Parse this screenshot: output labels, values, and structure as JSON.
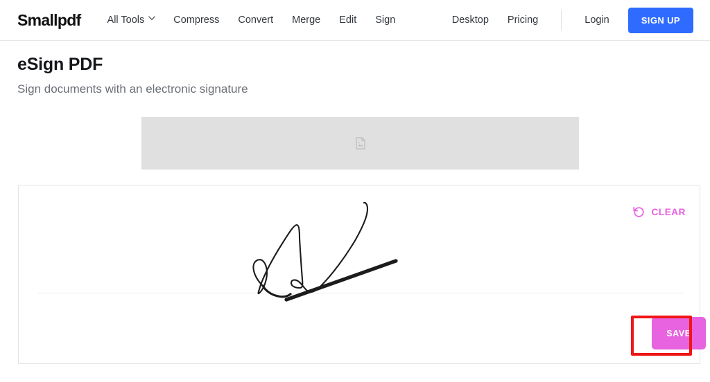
{
  "header": {
    "logo": "Smallpdf",
    "nav_main": [
      {
        "label": "All Tools",
        "icon": "chevron-down-icon",
        "has_chevron": true
      },
      {
        "label": "Compress",
        "has_chevron": false
      },
      {
        "label": "Convert",
        "has_chevron": false
      },
      {
        "label": "Merge",
        "has_chevron": false
      },
      {
        "label": "Edit",
        "has_chevron": false
      },
      {
        "label": "Sign",
        "has_chevron": false
      }
    ],
    "nav_right": [
      {
        "label": "Desktop"
      },
      {
        "label": "Pricing"
      }
    ],
    "login_label": "Login",
    "signup_label": "SIGN UP",
    "signup_color": "#2f6bff"
  },
  "page": {
    "title": "eSign PDF",
    "subtitle": "Sign documents with an electronic signature"
  },
  "doc_preview": {
    "icon": "document-icon",
    "background_color": "#e0e0e0"
  },
  "signature_pad": {
    "clear_label": "CLEAR",
    "clear_icon": "undo-icon",
    "accent_color": "#e75fe0",
    "save_label": "SAVE",
    "save_color": "#e763e0",
    "baseline_color": "#eaeaec",
    "ink_color": "#1c1c1c"
  },
  "annotation": {
    "highlight_target": "SAVE",
    "color": "#f01515"
  }
}
